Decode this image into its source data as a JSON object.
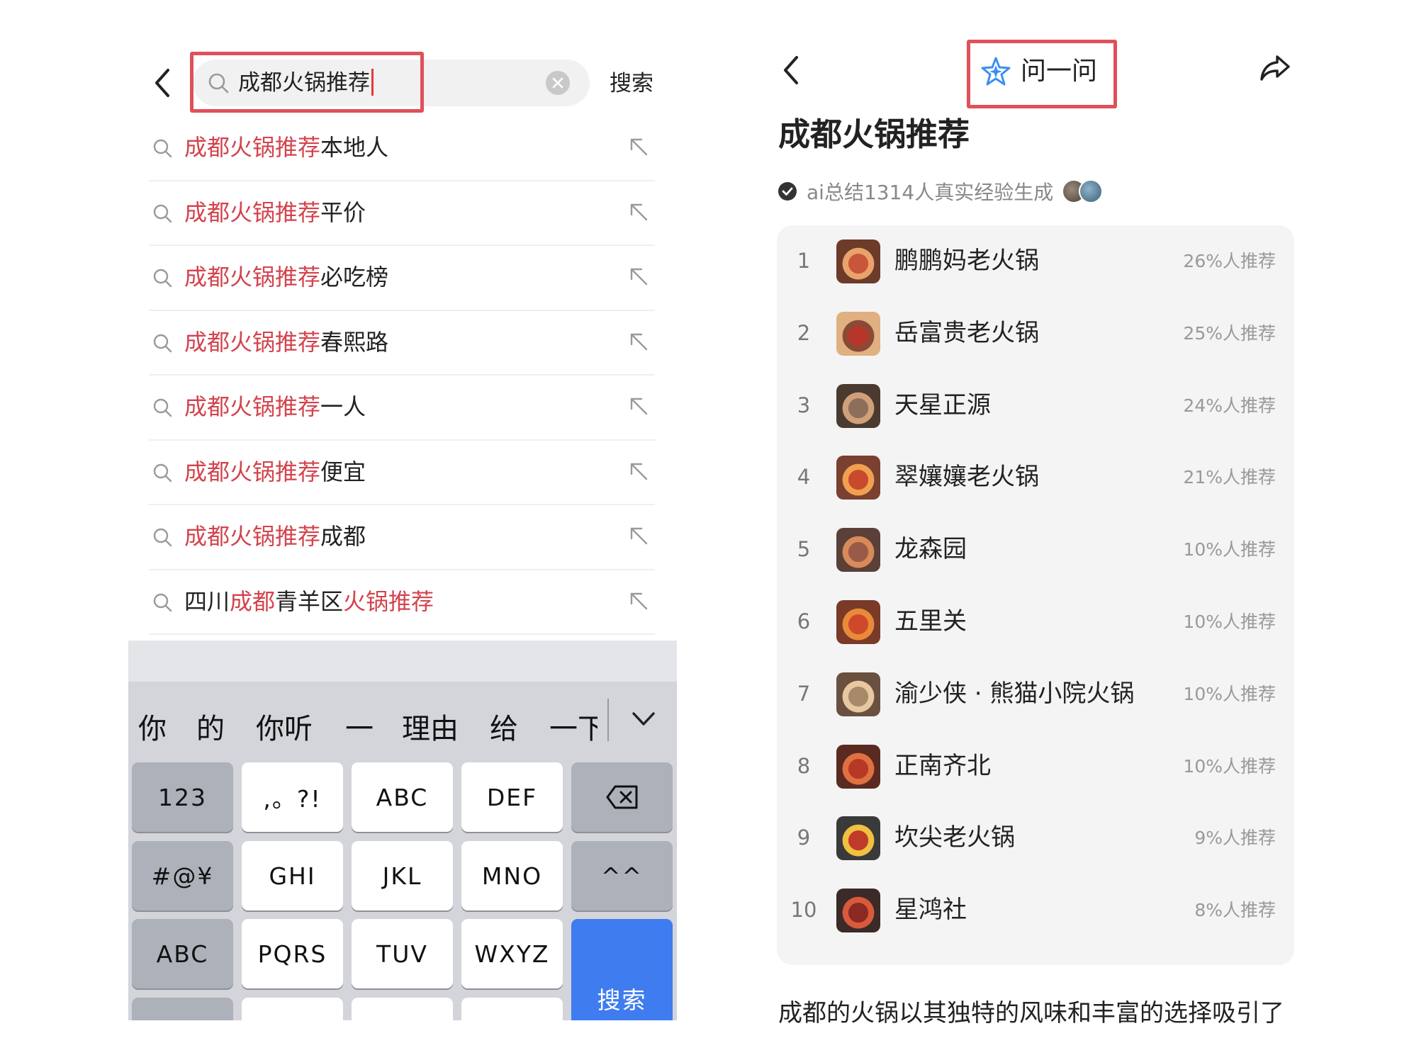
{
  "left": {
    "search": {
      "query": "成都火锅推荐",
      "button_label": "搜索"
    },
    "suggestions": [
      {
        "highlight": "成都火锅推荐",
        "rest": "本地人"
      },
      {
        "highlight": "成都火锅推荐",
        "rest": "平价"
      },
      {
        "highlight": "成都火锅推荐",
        "rest": "必吃榜"
      },
      {
        "highlight": "成都火锅推荐",
        "rest": "春熙路"
      },
      {
        "highlight": "成都火锅推荐",
        "rest": "一人"
      },
      {
        "highlight": "成都火锅推荐",
        "rest": "便宜"
      },
      {
        "highlight": "成都火锅推荐",
        "rest": "成都"
      },
      {
        "parts": [
          {
            "text": "四川",
            "red": false
          },
          {
            "text": "成都",
            "red": true
          },
          {
            "text": "青羊区",
            "red": false
          },
          {
            "text": "火锅推荐",
            "red": true
          }
        ]
      }
    ],
    "keyboard": {
      "candidates": [
        "你",
        "的",
        "你听",
        "一",
        "理由",
        "给",
        "一下"
      ],
      "rows": [
        [
          "123",
          ",。?!",
          "ABC",
          "DEF",
          "delete"
        ],
        [
          "#@¥",
          "GHI",
          "JKL",
          "MNO",
          "^^"
        ],
        [
          "ABC",
          "PQRS",
          "TUV",
          "WXYZ",
          "搜索"
        ]
      ],
      "search_key": "搜索"
    }
  },
  "right": {
    "ask_label": "问一问",
    "title": "成都火锅推荐",
    "meta": "ai总结1314人真实经验生成",
    "ranking": [
      {
        "rank": "1",
        "name": "鹏鹏妈老火锅",
        "pct": "26%人推荐"
      },
      {
        "rank": "2",
        "name": "岳富贵老火锅",
        "pct": "25%人推荐"
      },
      {
        "rank": "3",
        "name": "天星正源",
        "pct": "24%人推荐"
      },
      {
        "rank": "4",
        "name": "翠孃孃老火锅",
        "pct": "21%人推荐"
      },
      {
        "rank": "5",
        "name": "龙森园",
        "pct": "10%人推荐"
      },
      {
        "rank": "6",
        "name": "五里关",
        "pct": "10%人推荐"
      },
      {
        "rank": "7",
        "name": "渝少侠 · 熊猫小院火锅",
        "pct": "10%人推荐"
      },
      {
        "rank": "8",
        "name": "正南齐北",
        "pct": "10%人推荐"
      },
      {
        "rank": "9",
        "name": "坎尖老火锅",
        "pct": "9%人推荐"
      },
      {
        "rank": "10",
        "name": "星鸿社",
        "pct": "8%人推荐"
      }
    ],
    "body_text": "成都的火锅以其独特的风味和丰富的选择吸引了"
  },
  "colors": {
    "highlight_red": "#d3434d",
    "annotation_box": "#e0505a",
    "keyboard_blue": "#3e7cf0",
    "ai_icon_blue": "#3b8ff0"
  },
  "icons": [
    "back-chevron-icon",
    "search-icon",
    "clear-icon",
    "fill-arrow-icon",
    "delete-key-icon",
    "chevron-down-icon",
    "ai-sparkle-icon",
    "share-icon",
    "verified-check-icon"
  ]
}
